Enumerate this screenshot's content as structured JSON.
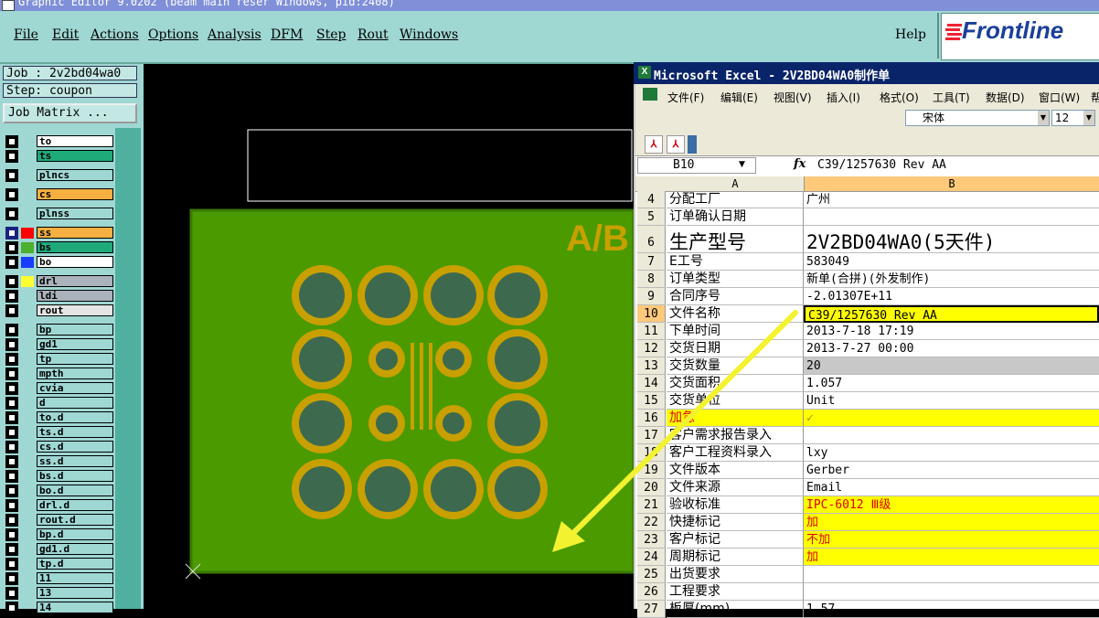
{
  "app": {
    "title_strip": "Graphic Editor 9.0202 (beam main reser  Windows, pid:2408)"
  },
  "menubar": {
    "items": [
      "File",
      "Edit",
      "Actions",
      "Options",
      "Analysis",
      "DFM",
      "Step",
      "Rout",
      "Windows"
    ],
    "help": "Help",
    "logo": "Frontline"
  },
  "leftpanel": {
    "job": "Job : 2v2bd04wa0",
    "step": "Step: coupon",
    "job_matrix": "Job Matrix ...",
    "layers": [
      {
        "name": "to",
        "color": "#ffffff",
        "swatch": ""
      },
      {
        "name": "ts",
        "color": "#1faa7a",
        "swatch": ""
      },
      {
        "name": "plncs",
        "color": "#9fd7d3",
        "swatch": ""
      },
      {
        "name": "cs",
        "color": "#f5b041",
        "swatch": ""
      },
      {
        "name": "plnss",
        "color": "#9fd7d3",
        "swatch": ""
      },
      {
        "name": "ss",
        "color": "#f5b041",
        "swatch": "#ff0000"
      },
      {
        "name": "bs",
        "color": "#1faa7a",
        "swatch": "#4caf30"
      },
      {
        "name": "bo",
        "color": "#ffffff",
        "swatch": "#1a3cff"
      },
      {
        "name": "drl",
        "color": "#aab2bb",
        "swatch": "#ffff33"
      },
      {
        "name": "ldi",
        "color": "#aab2bb",
        "swatch": ""
      },
      {
        "name": "rout",
        "color": "#e4e4e4",
        "swatch": ""
      },
      {
        "name": "bp",
        "color": "#9fd7d3",
        "swatch": ""
      },
      {
        "name": "gd1",
        "color": "#9fd7d3",
        "swatch": ""
      },
      {
        "name": "tp",
        "color": "#9fd7d3",
        "swatch": ""
      },
      {
        "name": "mpth",
        "color": "#9fd7d3",
        "swatch": ""
      },
      {
        "name": "cvia",
        "color": "#9fd7d3",
        "swatch": ""
      },
      {
        "name": "d",
        "color": "#9fd7d3",
        "swatch": ""
      },
      {
        "name": "to.d",
        "color": "#9fd7d3",
        "swatch": ""
      },
      {
        "name": "ts.d",
        "color": "#9fd7d3",
        "swatch": ""
      },
      {
        "name": "cs.d",
        "color": "#9fd7d3",
        "swatch": ""
      },
      {
        "name": "ss.d",
        "color": "#9fd7d3",
        "swatch": ""
      },
      {
        "name": "bs.d",
        "color": "#9fd7d3",
        "swatch": ""
      },
      {
        "name": "bo.d",
        "color": "#9fd7d3",
        "swatch": ""
      },
      {
        "name": "drl.d",
        "color": "#9fd7d3",
        "swatch": ""
      },
      {
        "name": "rout.d",
        "color": "#9fd7d3",
        "swatch": ""
      },
      {
        "name": "bp.d",
        "color": "#9fd7d3",
        "swatch": ""
      },
      {
        "name": "gd1.d",
        "color": "#9fd7d3",
        "swatch": ""
      },
      {
        "name": "tp.d",
        "color": "#9fd7d3",
        "swatch": ""
      },
      {
        "name": "11",
        "color": "#9fd7d3",
        "swatch": ""
      },
      {
        "name": "13",
        "color": "#9fd7d3",
        "swatch": ""
      },
      {
        "name": "14",
        "color": "#9fd7d3",
        "swatch": ""
      }
    ]
  },
  "canvas": {
    "mirror_text": "A/B"
  },
  "excel": {
    "title": "Microsoft Excel - 2V2BD04WA0制作单",
    "menus": [
      "文件(F)",
      "编辑(E)",
      "视图(V)",
      "插入(I)",
      "格式(O)",
      "工具(T)",
      "数据(D)",
      "窗口(W)",
      "帮"
    ],
    "font": "宋体",
    "size": "12",
    "namebox": "B10",
    "fx": "fx",
    "formula": "C39/1257630 Rev AA",
    "col_a": "A",
    "col_b": "B",
    "rows": [
      {
        "n": "4",
        "a": "分配工厂",
        "b": "广州",
        "style": ""
      },
      {
        "n": "5",
        "a": "订单确认日期",
        "b": "",
        "style": ""
      },
      {
        "n": "6",
        "a": "生产型号",
        "b": "2V2BD04WA0(5天件)",
        "style": "big"
      },
      {
        "n": "7",
        "a": "E工号",
        "b": "583049",
        "style": ""
      },
      {
        "n": "8",
        "a": "订单类型",
        "b": "新单(合拼)(外发制作)",
        "style": ""
      },
      {
        "n": "9",
        "a": "合同序号",
        "b": "-2.01307E+11",
        "style": ""
      },
      {
        "n": "10",
        "a": "文件名称",
        "b": "C39/1257630 Rev AA",
        "style": "yellowb"
      },
      {
        "n": "11",
        "a": "下单时间",
        "b": "2013-7-18 17:19",
        "style": ""
      },
      {
        "n": "12",
        "a": "交货日期",
        "b": "2013-7-27 00:00",
        "style": ""
      },
      {
        "n": "13",
        "a": "交货数量",
        "b": "20",
        "style": "grayb"
      },
      {
        "n": "14",
        "a": "交货面积",
        "b": "1.057",
        "style": ""
      },
      {
        "n": "15",
        "a": "交货单位",
        "b": "Unit",
        "style": ""
      },
      {
        "n": "16",
        "a": "加急",
        "b": "✓",
        "style": "yellowall"
      },
      {
        "n": "17",
        "a": "客户需求报告录入",
        "b": "",
        "style": ""
      },
      {
        "n": "18",
        "a": "客户工程资料录入",
        "b": "lxy",
        "style": ""
      },
      {
        "n": "19",
        "a": "文件版本",
        "b": "Gerber",
        "style": ""
      },
      {
        "n": "20",
        "a": "文件来源",
        "b": "Email",
        "style": ""
      },
      {
        "n": "21",
        "a": "验收标准",
        "b": "IPC-6012 Ⅲ级",
        "style": "yellowred"
      },
      {
        "n": "22",
        "a": "快捷标记",
        "b": "加",
        "style": "yellowred"
      },
      {
        "n": "23",
        "a": "客户标记",
        "b": "不加",
        "style": "yellowred"
      },
      {
        "n": "24",
        "a": "周期标记",
        "b": "加",
        "style": "yellowred"
      },
      {
        "n": "25",
        "a": "出货要求",
        "b": "",
        "style": ""
      },
      {
        "n": "26",
        "a": "工程要求",
        "b": "",
        "style": ""
      },
      {
        "n": "27",
        "a": "板厚(mm)",
        "b": "1.57",
        "style": ""
      }
    ]
  },
  "colors": {
    "menubar": "#9fd7d3",
    "board": "#4a9a00",
    "pad": "#c8a000",
    "pad_center": "#3d6a4f",
    "arrow": "#f2f230",
    "selection": "#ffff00"
  }
}
